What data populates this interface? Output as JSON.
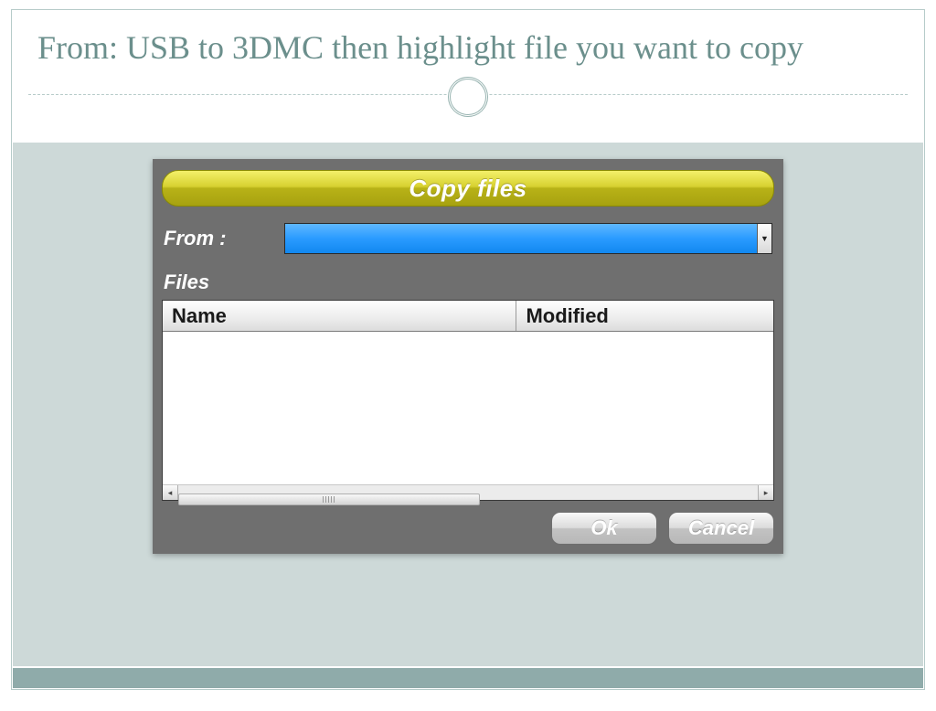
{
  "slide": {
    "title": "From: USB to 3DMC then highlight file you want to copy"
  },
  "dialog": {
    "title": "Copy files",
    "from_label": "From :",
    "from_value": "",
    "files_label": "Files",
    "columns": {
      "name": "Name",
      "modified": "Modified"
    },
    "rows": [],
    "buttons": {
      "ok": "Ok",
      "cancel": "Cancel"
    }
  }
}
